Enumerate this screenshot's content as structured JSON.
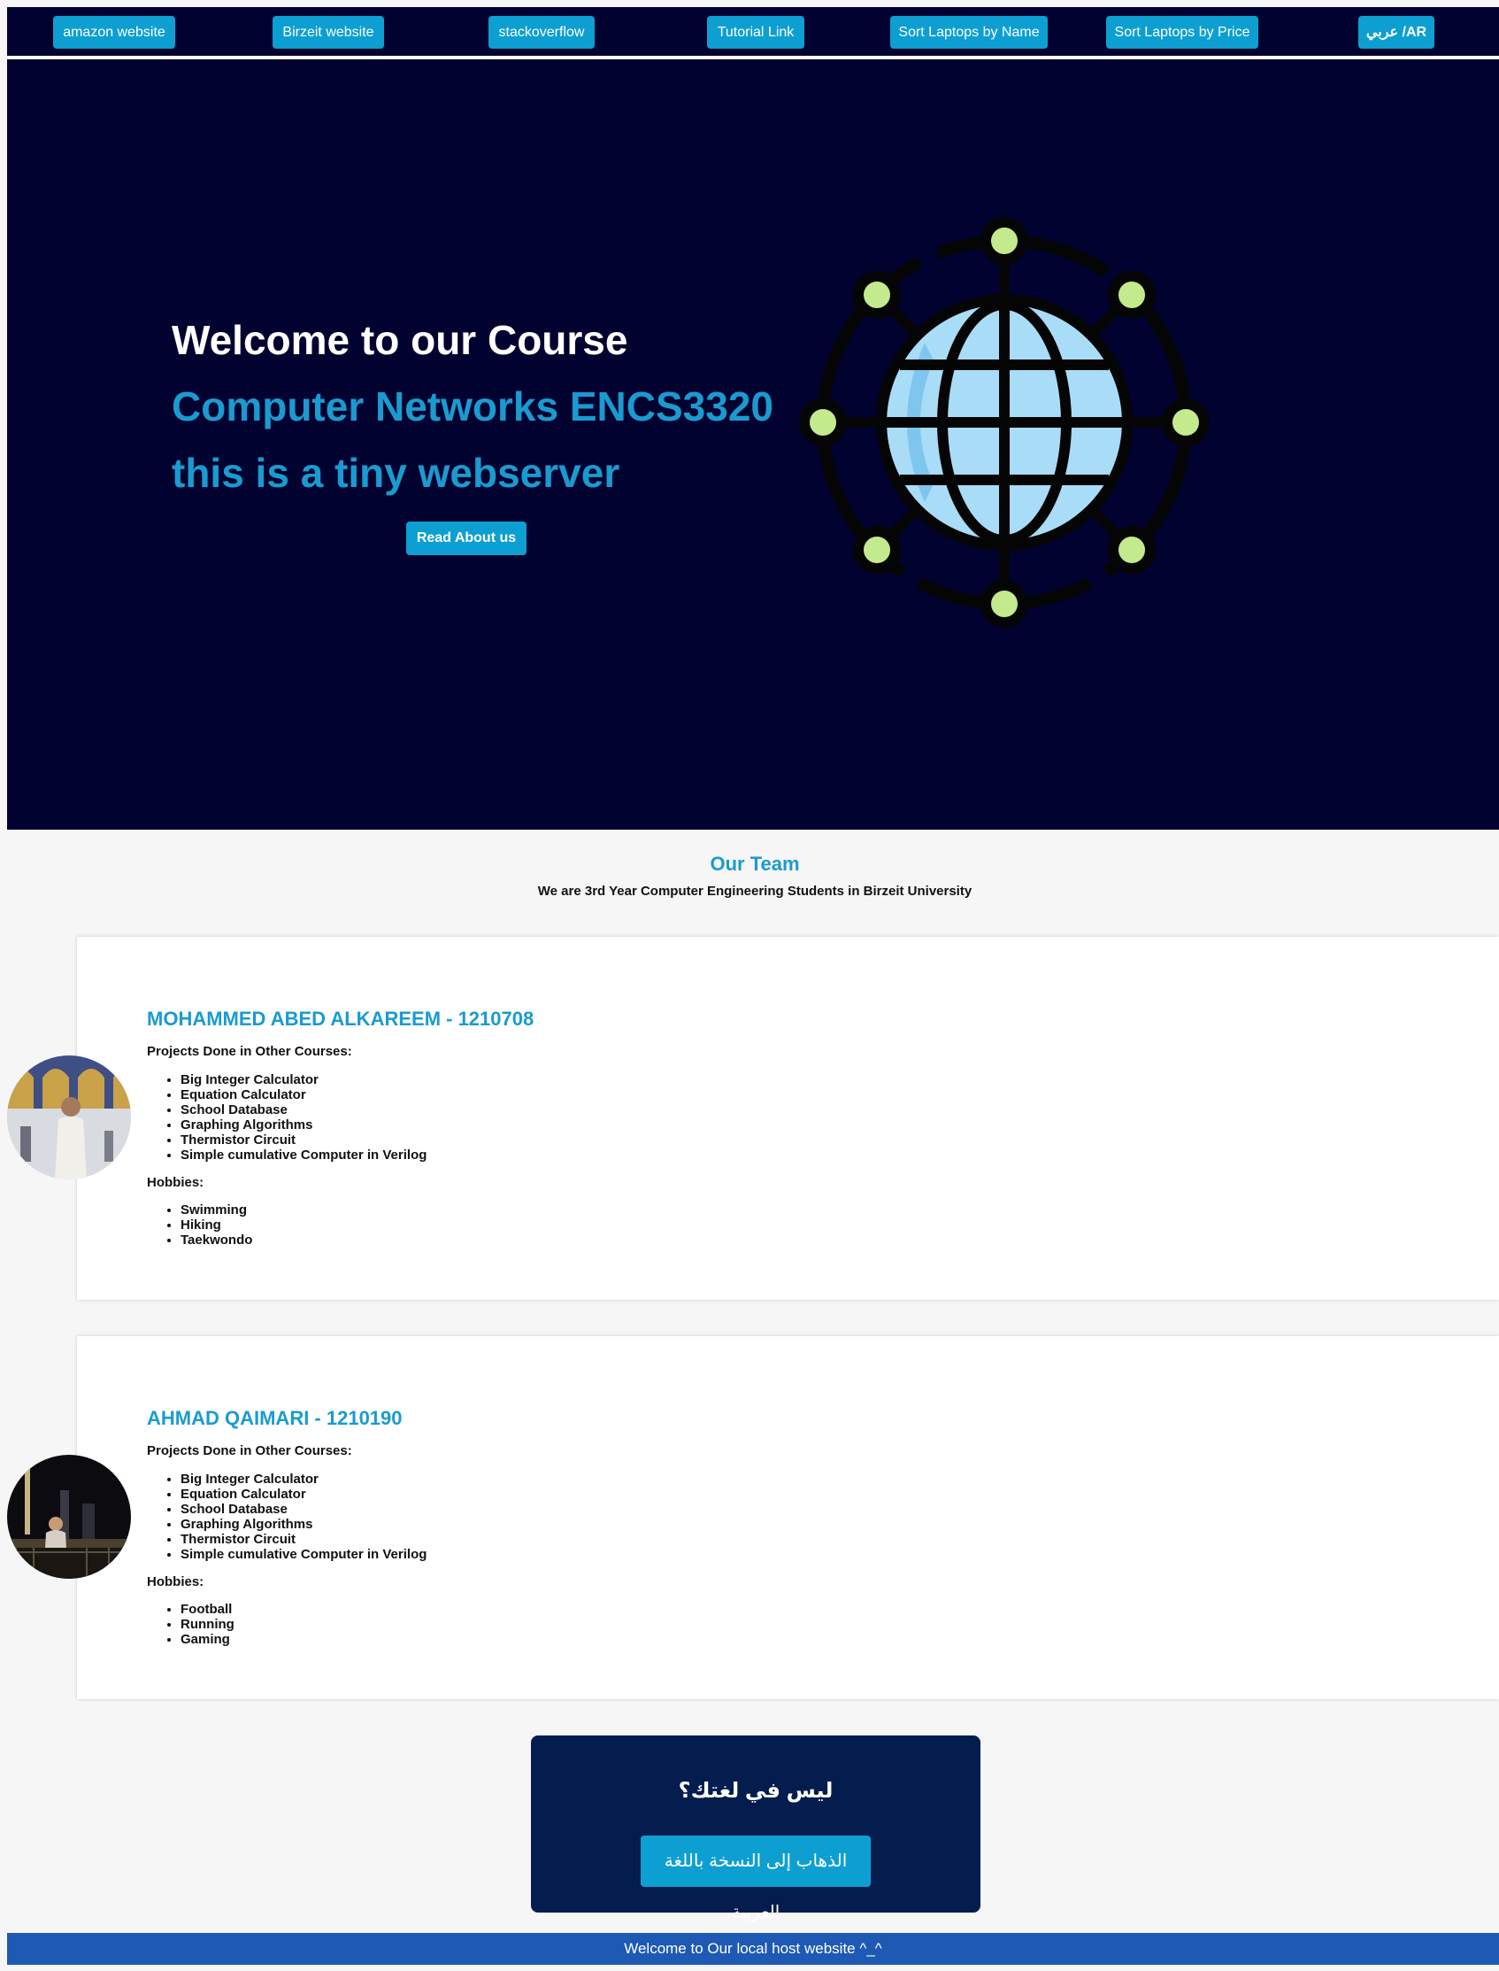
{
  "nav": {
    "links": [
      {
        "label": "amazon website"
      },
      {
        "label": "Birzeit website"
      },
      {
        "label": "stackoverflow"
      },
      {
        "label": "Tutorial Link"
      },
      {
        "label": "Sort Laptops by Name"
      },
      {
        "label": "Sort Laptops by Price"
      },
      {
        "label": "عربي /AR"
      }
    ]
  },
  "hero": {
    "title": "Welcome to our Course",
    "course": "Computer Networks ENCS3320",
    "tagline": "this is a tiny webserver",
    "button": "Read About us"
  },
  "team": {
    "title": "Our Team",
    "subtitle": "We are 3rd Year Computer Engineering Students in Birzeit University",
    "members": [
      {
        "name": "MOHAMMED ABED ALKAREEM - 1210708",
        "projects_label": "Projects Done in Other Courses:",
        "projects": [
          "Big Integer Calculator",
          "Equation Calculator",
          "School Database",
          "Graphing Algorithms",
          "Thermistor Circuit",
          "Simple cumulative Computer in Verilog"
        ],
        "hobbies_label": "Hobbies:",
        "hobbies": [
          "Swimming",
          "Hiking",
          "Taekwondo"
        ]
      },
      {
        "name": "AHMAD QAIMARI - 1210190",
        "projects_label": "Projects Done in Other Courses:",
        "projects": [
          "Big Integer Calculator",
          "Equation Calculator",
          "School Database",
          "Graphing Algorithms",
          "Thermistor Circuit",
          "Simple cumulative Computer in Verilog"
        ],
        "hobbies_label": "Hobbies:",
        "hobbies": [
          "Football",
          "Running",
          "Gaming"
        ]
      }
    ]
  },
  "arabic_box": {
    "title": "ليس في لغتك؟",
    "button": "الذهاب إلى النسخة باللغة العربية"
  },
  "footer": {
    "text": "Welcome to Our local host website ^_^"
  },
  "colors": {
    "nav_bg": "#020230",
    "accent": "#0d9fd1",
    "heading_blue": "#1a9bd0",
    "arabic_box_bg": "#041c4e",
    "footer_bg": "#1e59b3"
  }
}
